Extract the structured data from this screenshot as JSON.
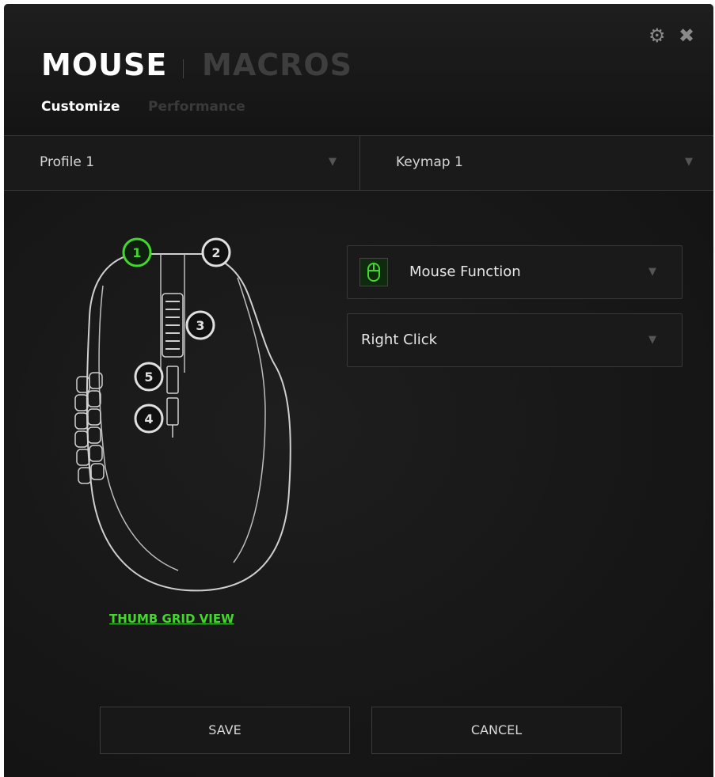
{
  "header": {
    "tab_mouse": "MOUSE",
    "tab_macros": "MACROS",
    "subtab_customize": "Customize",
    "subtab_performance": "Performance",
    "settings_icon": "gear-icon",
    "close_icon": "close-icon"
  },
  "selectors": {
    "profile": "Profile 1",
    "keymap": "Keymap 1"
  },
  "mouse_buttons": [
    "1",
    "2",
    "3",
    "5",
    "4"
  ],
  "selected_button": "1",
  "thumb_grid_link": "THUMB GRID VIEW",
  "function_dropdown": {
    "icon": "mouse-icon",
    "label": "Mouse Function"
  },
  "action_dropdown": {
    "label": "Right Click"
  },
  "buttons": {
    "save": "SAVE",
    "cancel": "CANCEL"
  },
  "colors": {
    "accent": "#44d62c",
    "background": "#1b1b1b"
  }
}
